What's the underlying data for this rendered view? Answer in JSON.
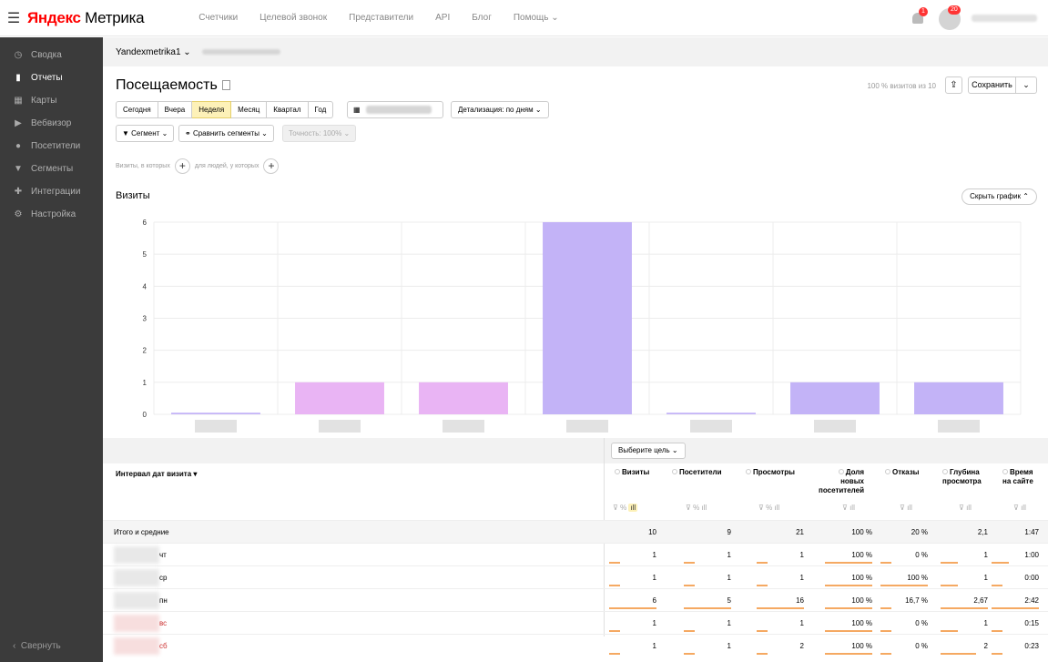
{
  "header": {
    "logo_brand": "Яндекс",
    "logo_product": "Метрика",
    "nav": [
      "Счетчики",
      "Целевой звонок",
      "Представители",
      "API",
      "Блог",
      "Помощь"
    ],
    "notifications_count": "1",
    "avatar_count": "20"
  },
  "sidebar": {
    "items": [
      {
        "label": "Сводка",
        "icon": "dashboard-icon"
      },
      {
        "label": "Отчеты",
        "icon": "reports-icon"
      },
      {
        "label": "Карты",
        "icon": "maps-icon"
      },
      {
        "label": "Вебвизор",
        "icon": "play-icon"
      },
      {
        "label": "Посетители",
        "icon": "user-icon"
      },
      {
        "label": "Сегменты",
        "icon": "filter-icon"
      },
      {
        "label": "Интеграции",
        "icon": "puzzle-icon"
      },
      {
        "label": "Настройка",
        "icon": "gear-icon"
      }
    ],
    "collapse": "Свернуть"
  },
  "counter": {
    "name": "Yandexmetrika1"
  },
  "report": {
    "title": "Посещаемость",
    "visits_of": "100 % визитов из 10",
    "save": "Сохранить"
  },
  "period": {
    "options": [
      "Сегодня",
      "Вчера",
      "Неделя",
      "Месяц",
      "Квартал",
      "Год"
    ],
    "selected": "Неделя"
  },
  "detail": "Детализация: по дням",
  "segments": {
    "segment": "Сегмент",
    "compare": "Сравнить сегменты",
    "accuracy": "Точность: 100%"
  },
  "filter": {
    "visits_where": "Визиты, в которых",
    "people_where": "для людей, у которых"
  },
  "chart_title": "Визиты",
  "hide_chart": "Скрыть график",
  "chart_data": {
    "type": "bar",
    "title": "Визиты",
    "ylim": [
      0,
      6
    ],
    "yticks": [
      "0",
      "1",
      "2",
      "3",
      "4",
      "5",
      "6"
    ],
    "values": [
      0.05,
      1,
      1,
      6,
      0.05,
      1,
      1
    ],
    "colors": [
      "#c3b3f7",
      "#e9b4f4",
      "#e9b4f4",
      "#c3b3f7",
      "#c3b3f7",
      "#c3b3f7",
      "#c3b3f7"
    ],
    "grid": true
  },
  "table": {
    "goal_button": "Выберите цель",
    "dimension_header": "Интервал дат визита",
    "columns": [
      "Визиты",
      "Посетители",
      "Просмотры",
      "Доля новых посетителей",
      "Отказы",
      "Глубина просмотра",
      "Время на сайте"
    ],
    "total_label": "Итого и средние",
    "total": [
      "10",
      "9",
      "21",
      "100 %",
      "20 %",
      "2,1",
      "1:47"
    ],
    "rows": [
      {
        "day": "чт",
        "values": [
          "1",
          "1",
          "1",
          "100 %",
          "0 %",
          "1",
          "1:00"
        ],
        "red": false
      },
      {
        "day": "ср",
        "values": [
          "1",
          "1",
          "1",
          "100 %",
          "100 %",
          "1",
          "0:00"
        ],
        "red": false
      },
      {
        "day": "пн",
        "values": [
          "6",
          "5",
          "16",
          "100 %",
          "16,7 %",
          "2,67",
          "2:42"
        ],
        "red": false
      },
      {
        "day": "вс",
        "values": [
          "1",
          "1",
          "1",
          "100 %",
          "0 %",
          "1",
          "0:15"
        ],
        "red": true
      },
      {
        "day": "сб",
        "values": [
          "1",
          "1",
          "2",
          "100 %",
          "0 %",
          "2",
          "0:23"
        ],
        "red": true
      }
    ]
  }
}
